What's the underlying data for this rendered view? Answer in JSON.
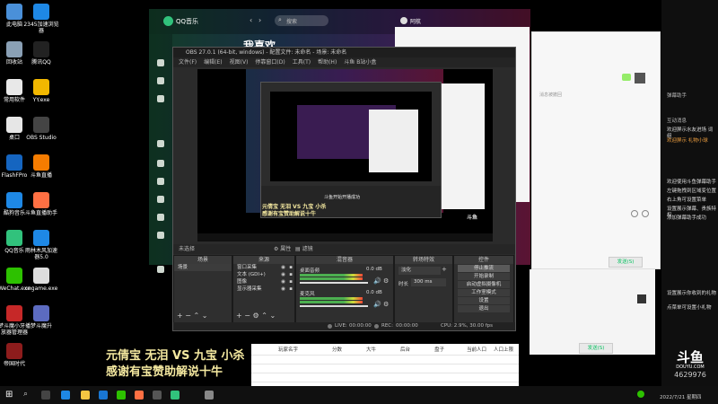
{
  "desktop_icons": [
    {
      "label": "此电脑",
      "color": "#4a90d9",
      "col": 0,
      "row": 0
    },
    {
      "label": "2345加速浏览器",
      "color": "#1e88e5",
      "col": 1,
      "row": 0
    },
    {
      "label": "回收站",
      "color": "#8aa0b5",
      "col": 0,
      "row": 1
    },
    {
      "label": "腾讯QQ",
      "color": "#222",
      "col": 1,
      "row": 1
    },
    {
      "label": "常用软件",
      "color": "#e8e8e8",
      "col": 0,
      "row": 2
    },
    {
      "label": "YY.exe",
      "color": "#f2b800",
      "col": 1,
      "row": 2
    },
    {
      "label": "桌口",
      "color": "#e6e6e6",
      "col": 0,
      "row": 3
    },
    {
      "label": "OBS Studio",
      "color": "#444",
      "col": 1,
      "row": 3
    },
    {
      "label": "FlashFPro",
      "color": "#1565c0",
      "col": 0,
      "row": 4
    },
    {
      "label": "斗鱼直播",
      "color": "#f57c00",
      "col": 1,
      "row": 4
    },
    {
      "label": "酷狗音乐",
      "color": "#1e88e5",
      "col": 0,
      "row": 5
    },
    {
      "label": "斗鱼直播助手",
      "color": "#ff7043",
      "col": 1,
      "row": 5
    },
    {
      "label": "QQ音乐",
      "color": "#31c27c",
      "col": 0,
      "row": 6
    },
    {
      "label": "雨林木风加速器5.0",
      "color": "#1e88e5",
      "col": 1,
      "row": 6
    },
    {
      "label": "WeChat.exe",
      "color": "#2dc100",
      "col": 0,
      "row": 7
    },
    {
      "label": "cngame.exe",
      "color": "#ddd",
      "col": 1,
      "row": 7
    },
    {
      "label": "梦斗魔小牙播放器管理器",
      "color": "#c62828",
      "col": 0,
      "row": 8
    },
    {
      "label": "梦斗魔升",
      "color": "#5c6bc0",
      "col": 1,
      "row": 8
    },
    {
      "label": "帝国时代",
      "color": "#8d1c1c",
      "col": 0,
      "row": 9
    }
  ],
  "qq_music": {
    "title": "QQ音乐",
    "search_placeholder": "搜索",
    "user": "阿航",
    "heading": "我喜欢"
  },
  "obs": {
    "title": "OBS 27.0.1 (64-bit, windows) - 配置文件: 未命名 - 场景: 未命名",
    "menus": [
      "文件(F)",
      "编辑(E)",
      "视图(V)",
      "停靠窗口(D)",
      "工具(T)",
      "帮助(H)",
      "斗鱼 B站小盒"
    ],
    "filter_bar": [
      "未选择",
      "属性",
      "滤镜"
    ],
    "docks": {
      "scenes": {
        "title": "场景",
        "items": [
          "场景"
        ]
      },
      "sources": {
        "title": "来源",
        "items": [
          "窗口采集",
          "文本 (GDI+)",
          "图像",
          "显示器采集"
        ]
      },
      "mixer": {
        "title": "混音器",
        "tracks": [
          {
            "name": "桌面音频",
            "value": "0.0 dB"
          },
          {
            "name": "麦克风",
            "value": "0.0 dB"
          }
        ]
      },
      "transitions": {
        "title": "转场特效",
        "type": "淡化",
        "duration_label": "时长",
        "duration": "300 ms"
      },
      "controls": {
        "title": "控件",
        "buttons": [
          "停止推流",
          "开始录制",
          "启动虚拟摄像机",
          "工作室模式",
          "设置",
          "退出"
        ]
      }
    },
    "status": {
      "live_label": "LIVE:",
      "live_time": "00:00:00",
      "rec_label": "REC:",
      "rec_time": "00:00:00",
      "cpu": "CPU: 2.9%, 30.00 fps"
    },
    "nested_toast": "斗鱼开始开播成功"
  },
  "overlay": {
    "line1": "元倩宝 无泪 VS 九宝 小杀",
    "line2": "感谢有宝赞助解说十牛"
  },
  "wechat_windows": {
    "notice": "消息被撤回",
    "send_button": "发送(S)"
  },
  "chat_panel": {
    "lines": [
      {
        "text": "弹幕助手",
        "color": "#bbbbbb"
      },
      {
        "text": "互动消息",
        "color": "#bbbbbb"
      },
      {
        "text": "欢迎屏示水友进场 词组",
        "color": "#dddddd"
      },
      {
        "text": "欢迎屏示 礼物小球",
        "color": "#f0a040"
      },
      {
        "text": "欢迎使用斗鱼弹幕助手",
        "color": "#dddddd"
      },
      {
        "text": "左键拖拽到区域变位置",
        "color": "#dddddd"
      },
      {
        "text": "右上角可设置菜单",
        "color": "#dddddd"
      },
      {
        "text": "设置展示弹幕、贵族特权",
        "color": "#dddddd"
      },
      {
        "text": "添加弹幕助手成功",
        "color": "#dddddd"
      },
      {
        "text": "设置展示你收到的礼物",
        "color": "#dddddd"
      },
      {
        "text": "点菜单可设置小礼物",
        "color": "#dddddd"
      }
    ],
    "logo_mark": "斗鱼",
    "logo_site": "DOUYU.COM",
    "room_id": "4629976"
  },
  "sheet": {
    "headers": [
      "玩家名字",
      "分数",
      "大牛",
      "后台",
      "盘子",
      "当前人口",
      "人口上限"
    ]
  },
  "taskbar": {
    "time": "",
    "date": "2022/7/21 星期四"
  }
}
